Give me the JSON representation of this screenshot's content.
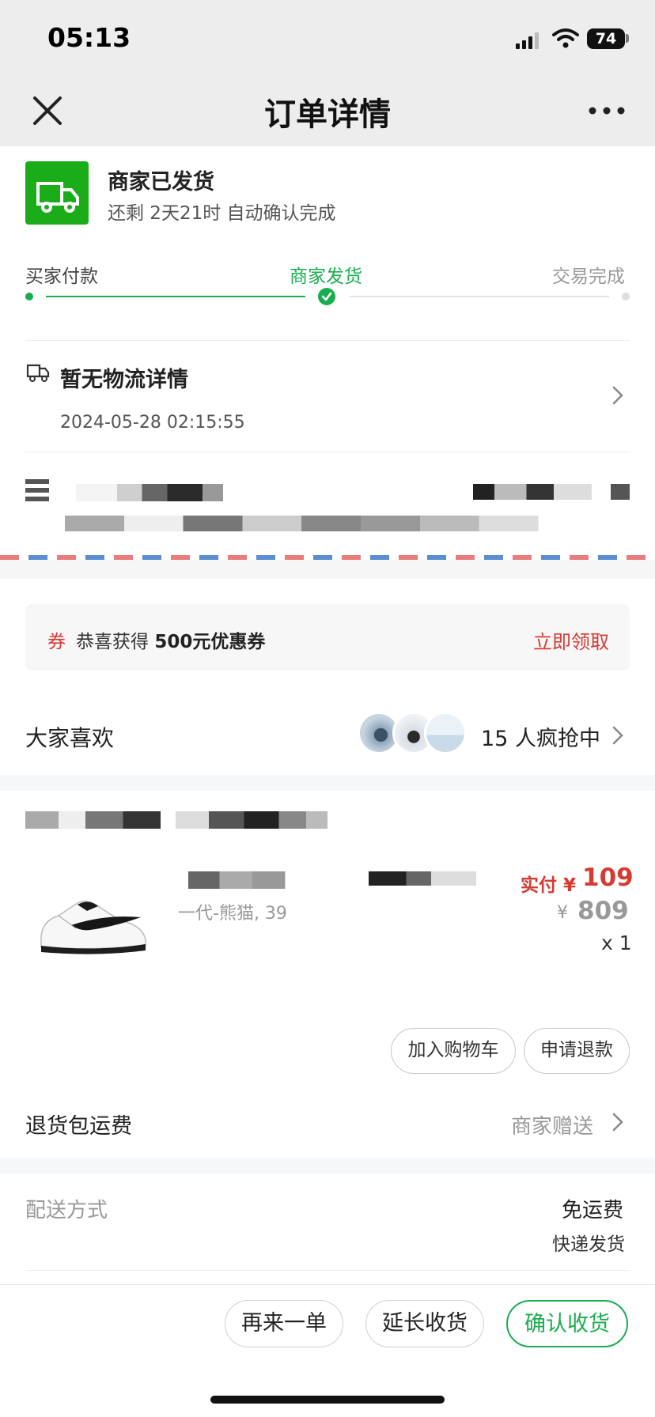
{
  "status_bar": {
    "time": "05:13",
    "battery": "74"
  },
  "nav": {
    "title": "订单详情"
  },
  "order_status": {
    "title": "商家已发货",
    "subtitle": "还剩 2天21时 自动确认完成"
  },
  "progress": {
    "steps": [
      "买家付款",
      "商家发货",
      "交易完成"
    ],
    "current": 1
  },
  "logistics": {
    "title": "暂无物流详情",
    "time": "2024-05-28 02:15:55"
  },
  "coupon": {
    "tag": "券",
    "text_prefix": "恭喜获得 ",
    "text_bold": "500元优惠券",
    "action": "立即领取"
  },
  "popular": {
    "label": "大家喜欢",
    "count": "15 人疯抢中"
  },
  "product": {
    "variant": "一代-熊猫, 39",
    "paid_label": "实付 ¥",
    "paid_value": "109",
    "currency": "¥",
    "original_value": "809",
    "quantity": "x 1",
    "actions": [
      "加入购物车",
      "申请退款"
    ]
  },
  "return_shipping": {
    "label": "退货包运费",
    "value": "商家赠送"
  },
  "delivery": {
    "label": "配送方式",
    "value": "免运费",
    "method": "快递发货"
  },
  "bottom_actions": [
    "再来一单",
    "延长收货",
    "确认收货"
  ],
  "colors": {
    "green": "#1aad4f",
    "red": "#d43c33",
    "nav_bg": "#ededed"
  }
}
